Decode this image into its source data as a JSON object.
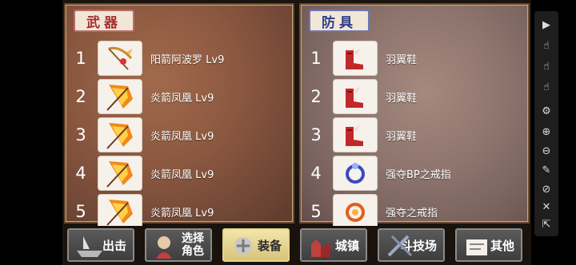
{
  "weapons": {
    "title": "武器",
    "items": [
      {
        "index": "1",
        "name": "阳箭阿波罗 Lv9",
        "icon": "golden-bow-icon"
      },
      {
        "index": "2",
        "name": "炎箭凤凰 Lv9",
        "icon": "fire-bow-icon"
      },
      {
        "index": "3",
        "name": "炎箭凤凰 Lv9",
        "icon": "fire-bow-icon"
      },
      {
        "index": "4",
        "name": "炎箭凤凰 Lv9",
        "icon": "fire-bow-icon"
      },
      {
        "index": "5",
        "name": "炎箭凤凰 Lv9",
        "icon": "fire-bow-icon"
      }
    ]
  },
  "armor": {
    "title": "防具",
    "items": [
      {
        "index": "1",
        "name": "羽翼鞋",
        "icon": "winged-boots-icon"
      },
      {
        "index": "2",
        "name": "羽翼鞋",
        "icon": "winged-boots-icon"
      },
      {
        "index": "3",
        "name": "羽翼鞋",
        "icon": "winged-boots-icon"
      },
      {
        "index": "4",
        "name": "强夺BP之戒指",
        "icon": "blue-ring-icon"
      },
      {
        "index": "5",
        "name": "强夺之戒指",
        "icon": "red-ring-icon"
      }
    ]
  },
  "nav": {
    "sortie": "出击",
    "select_line1": "选择",
    "select_line2": "角色",
    "equip": "装备",
    "castle": "城镇",
    "arena": "斗技场",
    "other": "其他"
  },
  "colors": {
    "weapon_title": "#a42f2f",
    "armor_title": "#2f3f8a",
    "active_nav": "#e9d48a"
  },
  "side_tools": [
    "play-icon",
    "tap-icon",
    "tap-icon",
    "tap-icon",
    "gear-icon",
    "plus-icon",
    "minus-icon",
    "script-icon",
    "eye-off-icon",
    "close-icon",
    "collapse-icon"
  ]
}
